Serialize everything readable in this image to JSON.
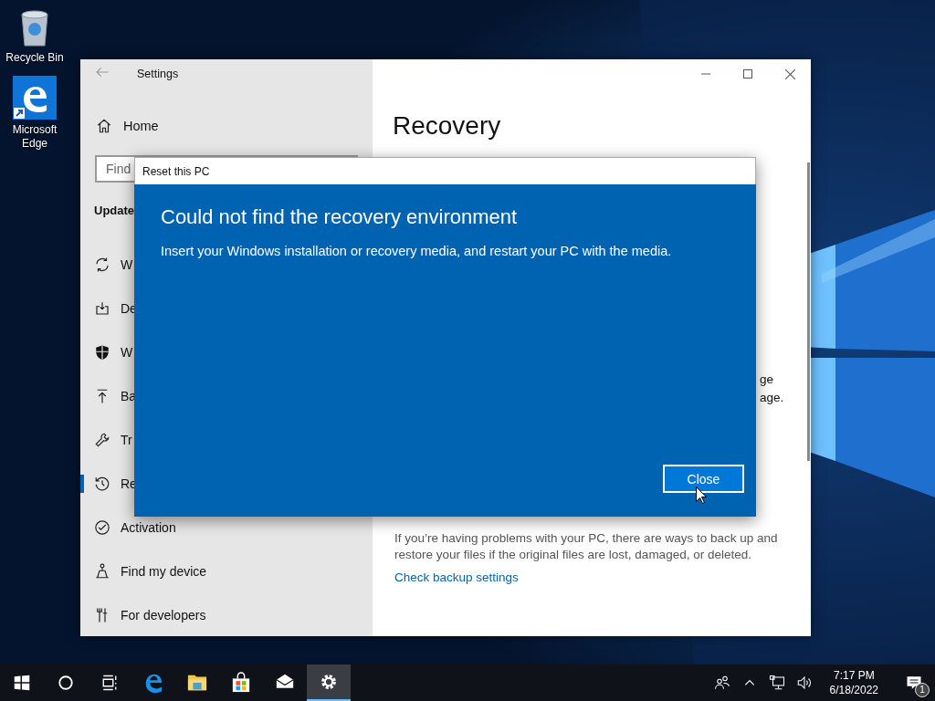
{
  "desktop": {
    "icons": [
      {
        "kind": "recycle",
        "label": "Recycle Bin"
      },
      {
        "kind": "edge",
        "label": "Microsoft Edge"
      }
    ]
  },
  "settings_window": {
    "title": "Settings",
    "home": "Home",
    "search": {
      "placeholder": "Find"
    },
    "section": "Update",
    "nav": [
      {
        "kind": "sync",
        "label": "W",
        "selected": false
      },
      {
        "kind": "delivery",
        "label": "De",
        "selected": false
      },
      {
        "kind": "shield",
        "label": "W",
        "selected": false
      },
      {
        "kind": "backup",
        "label": "Ba",
        "selected": false
      },
      {
        "kind": "wrench",
        "label": "Tr",
        "selected": false
      },
      {
        "kind": "history",
        "label": "Re",
        "selected": true
      },
      {
        "kind": "check",
        "label": "Activation",
        "selected": false
      },
      {
        "kind": "person",
        "label": "Find my device",
        "selected": false
      },
      {
        "kind": "tools",
        "label": "For developers",
        "selected": false
      }
    ],
    "page": {
      "title": "Recovery",
      "fragments": [
        "ge",
        "age."
      ],
      "paragraph": "If you’re having problems with your PC, there are ways to back up and restore your files if the original files are lost, damaged, or deleted.",
      "link": "Check backup settings"
    }
  },
  "dialog": {
    "title": "Reset this PC",
    "heading": "Could not find the recovery environment",
    "message": "Insert your Windows installation or recovery media, and restart your PC with the media.",
    "button": "Close"
  },
  "taskbar": {
    "apps": [
      {
        "kind": "start",
        "active": false
      },
      {
        "kind": "cortana",
        "active": false
      },
      {
        "kind": "taskview",
        "active": false
      },
      {
        "kind": "edge",
        "active": false
      },
      {
        "kind": "explorer",
        "active": false
      },
      {
        "kind": "store",
        "active": false
      },
      {
        "kind": "mail",
        "active": false
      },
      {
        "kind": "settings",
        "active": true
      }
    ],
    "time": "7:17 PM",
    "date": "6/18/2022",
    "notifications": "1"
  }
}
